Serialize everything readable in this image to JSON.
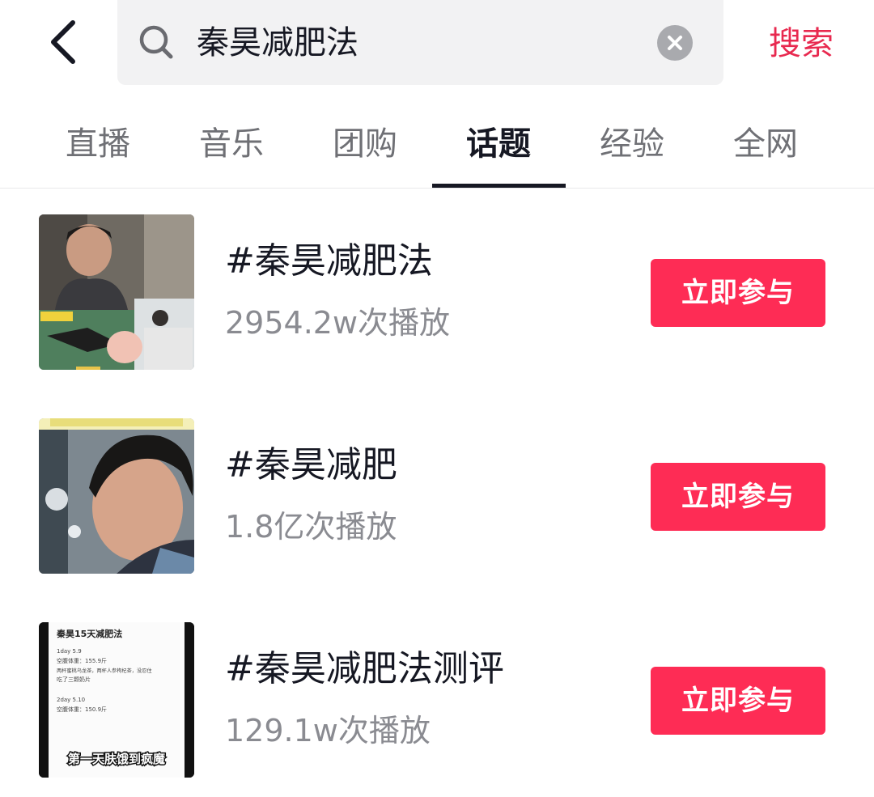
{
  "search": {
    "query": "秦昊减肥法",
    "submit_label": "搜索"
  },
  "tabs": [
    {
      "label": "直播",
      "active": false
    },
    {
      "label": "音乐",
      "active": false
    },
    {
      "label": "团购",
      "active": false
    },
    {
      "label": "话题",
      "active": true
    },
    {
      "label": "经验",
      "active": false
    },
    {
      "label": "全网",
      "active": false
    }
  ],
  "results": [
    {
      "title": "#秦昊减肥法",
      "plays": "2954.2w次播放",
      "action": "立即参与"
    },
    {
      "title": "#秦昊减肥",
      "plays": "1.8亿次播放",
      "action": "立即参与"
    },
    {
      "title": "#秦昊减肥法测评",
      "plays": "129.1w次播放",
      "action": "立即参与",
      "thumbnail_text": {
        "heading": "秦昊15天减肥法",
        "day1": "1day    5.9",
        "day1_weight": "空腹体重：155.9斤",
        "day1_note_a": "两杯蜜桃乌龙茶，两杯人参枸杞茶，没忍住",
        "day1_note_b": "吃了三颗奶片",
        "day2": "2day    5.10",
        "day2_weight": "空腹体重：150.9斤",
        "caption": "第一天肤饿到疯魔"
      }
    }
  ],
  "colors": {
    "accent": "#fe2c55",
    "search_label": "#e8294f",
    "text_primary": "#161823",
    "text_secondary": "#8a8b91"
  },
  "icons": {
    "back": "chevron-left-icon",
    "search": "search-icon",
    "clear": "clear-icon"
  }
}
